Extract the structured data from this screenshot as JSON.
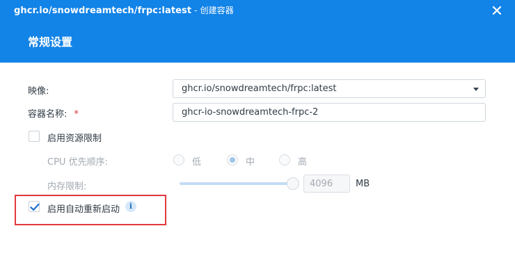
{
  "window": {
    "title": "ghcr.io/snowdreamtech/frpc:latest",
    "title_suffix": " - 创建容器",
    "close_icon": "close-icon",
    "header_color": "#1283e7"
  },
  "section": {
    "title": "常规设置"
  },
  "form": {
    "image": {
      "label": "映像:",
      "value": "ghcr.io/snowdreamtech/frpc:latest"
    },
    "container_name": {
      "label": "容器名称:",
      "required_mark": "*",
      "value": "ghcr-io-snowdreamtech-frpc-2"
    },
    "resource_limit": {
      "label": "启用资源限制",
      "checked": false
    },
    "cpu_priority": {
      "label": "CPU 优先顺序:",
      "options": [
        "低",
        "中",
        "高"
      ],
      "selected": "中",
      "disabled": true
    },
    "memory_limit": {
      "label": "内存限制:",
      "value": "4096",
      "unit": "MB",
      "slider_level": 1.0,
      "disabled": true
    },
    "auto_restart": {
      "label": "启用自动重新启动",
      "checked": true,
      "info_icon": "info-icon",
      "info_glyph": "i"
    }
  },
  "colors": {
    "accent": "#1283e7",
    "highlight_border": "#e3383c",
    "required": "#e0363a"
  }
}
